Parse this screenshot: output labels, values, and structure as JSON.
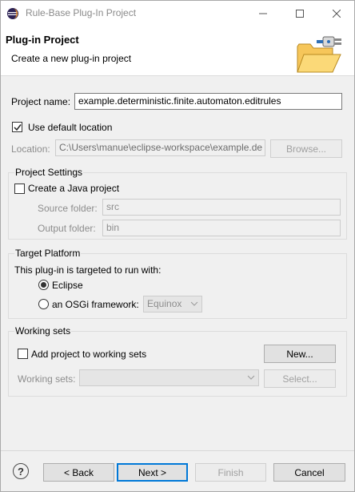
{
  "window": {
    "title": "Rule-Base Plug-In Project",
    "minimize_icon": "minimize-icon",
    "maximize_icon": "maximize-icon",
    "close_icon": "close-icon"
  },
  "banner": {
    "heading": "Plug-in Project",
    "description": "Create a new plug-in project",
    "image_icon": "folder-plug-icon"
  },
  "project": {
    "name_label": "Project name:",
    "name_value": "example.deterministic.finite.automaton.editrules",
    "use_default_label": "Use default location",
    "use_default_checked": true,
    "location_label": "Location:",
    "location_value": "C:\\Users\\manue\\eclipse-workspace\\example.de",
    "browse_label": "Browse..."
  },
  "project_settings": {
    "title": "Project Settings",
    "java_label": "Create a Java project",
    "java_checked": false,
    "source_label": "Source folder:",
    "source_value": "src",
    "output_label": "Output folder:",
    "output_value": "bin"
  },
  "target_platform": {
    "title": "Target Platform",
    "intro": "This plug-in is targeted to run with:",
    "eclipse_label": "Eclipse",
    "osgi_label": "an OSGi framework:",
    "osgi_value": "Equinox",
    "selected": "Eclipse"
  },
  "working_sets": {
    "title": "Working sets",
    "add_label": "Add project to working sets",
    "add_checked": false,
    "new_label": "New...",
    "sets_label": "Working sets:",
    "sets_value": "",
    "select_label": "Select..."
  },
  "footer": {
    "help_icon": "help-icon",
    "help_glyph": "?",
    "back_label": "< Back",
    "next_label": "Next >",
    "finish_label": "Finish",
    "cancel_label": "Cancel"
  },
  "colors": {
    "accent": "#0078d7",
    "background": "#f0f0f0"
  }
}
